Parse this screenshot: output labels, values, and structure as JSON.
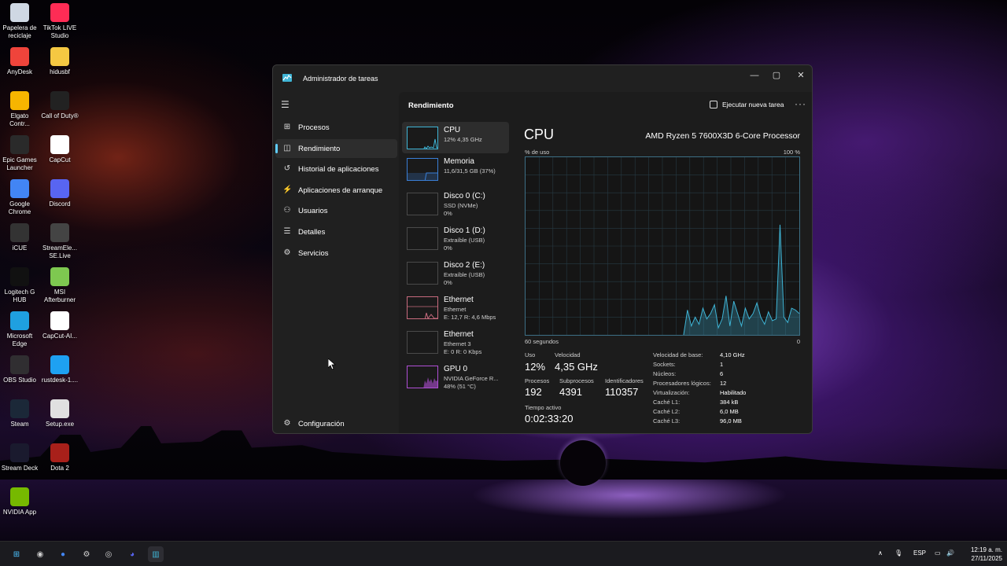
{
  "desktop_icons": [
    {
      "label": "Papelera de reciclaje",
      "icon": "recycle-bin-icon",
      "color": "#cfd8e3"
    },
    {
      "label": "TikTok LIVE Studio",
      "icon": "tiktok-icon",
      "color": "#fe2c55"
    },
    {
      "label": "AnyDesk",
      "icon": "anydesk-icon",
      "color": "#ef443b"
    },
    {
      "label": "hidusbf",
      "icon": "folder-icon",
      "color": "#f5c842"
    },
    {
      "label": "Elgato Contr...",
      "icon": "elgato-icon",
      "color": "#f7b500"
    },
    {
      "label": "Call of Duty®",
      "icon": "call-of-duty-icon",
      "color": "#222222"
    },
    {
      "label": "Epic Games Launcher",
      "icon": "epic-games-icon",
      "color": "#2a2a2a"
    },
    {
      "label": "CapCut",
      "icon": "capcut-icon",
      "color": "#ffffff"
    },
    {
      "label": "Google Chrome",
      "icon": "chrome-icon",
      "color": "#4285f4"
    },
    {
      "label": "Discord",
      "icon": "discord-icon",
      "color": "#5865f2"
    },
    {
      "label": "iCUE",
      "icon": "icue-icon",
      "color": "#333333"
    },
    {
      "label": "StreamEle... SE.Live",
      "icon": "streamelements-icon",
      "color": "#444444"
    },
    {
      "label": "Logitech G HUB",
      "icon": "logitech-icon",
      "color": "#111111"
    },
    {
      "label": "MSI Afterburner",
      "icon": "msi-afterburner-icon",
      "color": "#7ec850"
    },
    {
      "label": "Microsoft Edge",
      "icon": "edge-icon",
      "color": "#1fa0e0"
    },
    {
      "label": "CapCut-AI...",
      "icon": "capcut-ai-icon",
      "color": "#ffffff"
    },
    {
      "label": "OBS Studio",
      "icon": "obs-icon",
      "color": "#302e31"
    },
    {
      "label": "rustdesk-1....",
      "icon": "rustdesk-icon",
      "color": "#1ea1f2"
    },
    {
      "label": "Steam",
      "icon": "steam-icon",
      "color": "#1b2838"
    },
    {
      "label": "Setup.exe",
      "icon": "setup-icon",
      "color": "#e0e0e0"
    },
    {
      "label": "Stream Deck",
      "icon": "stream-deck-icon",
      "color": "#1a1a2e"
    },
    {
      "label": "Dota 2",
      "icon": "dota2-icon",
      "color": "#a8201a"
    },
    {
      "label": "NVIDIA App",
      "icon": "nvidia-icon",
      "color": "#76b900"
    }
  ],
  "window": {
    "title": "Administrador de tareas",
    "controls": {
      "minimize": "—",
      "maximize": "▢",
      "close": "✕"
    }
  },
  "nav": {
    "items": [
      {
        "label": "Procesos",
        "icon": "processes-icon",
        "glyph": "⊞"
      },
      {
        "label": "Rendimiento",
        "icon": "performance-icon",
        "glyph": "◫"
      },
      {
        "label": "Historial de aplicaciones",
        "icon": "history-icon",
        "glyph": "↺"
      },
      {
        "label": "Aplicaciones de arranque",
        "icon": "startup-icon",
        "glyph": "⚡"
      },
      {
        "label": "Usuarios",
        "icon": "users-icon",
        "glyph": "⚇"
      },
      {
        "label": "Detalles",
        "icon": "details-icon",
        "glyph": "☰"
      },
      {
        "label": "Servicios",
        "icon": "services-icon",
        "glyph": "⚙"
      }
    ],
    "settings": "Configuración"
  },
  "header": {
    "title": "Rendimiento",
    "run_task": "Ejecutar nueva tarea",
    "more": "···"
  },
  "resources": [
    {
      "name": "CPU",
      "sub1": "12% 4,35 GHz",
      "sub2": "",
      "sub3": "",
      "color": "#3fb5d6"
    },
    {
      "name": "Memoria",
      "sub1": "11,6/31,5 GB (37%)",
      "sub2": "",
      "sub3": "",
      "color": "#3a7fd6"
    },
    {
      "name": "Disco 0 (C:)",
      "sub1": "SSD (NVMe)",
      "sub2": "0%",
      "sub3": "",
      "color": "#4ca843"
    },
    {
      "name": "Disco 1 (D:)",
      "sub1": "Extraíble (USB)",
      "sub2": "0%",
      "sub3": "",
      "color": "#4ca843"
    },
    {
      "name": "Disco 2 (E:)",
      "sub1": "Extraíble (USB)",
      "sub2": "0%",
      "sub3": "",
      "color": "#4ca843"
    },
    {
      "name": "Ethernet",
      "sub1": "Ethernet",
      "sub2": "E: 12,7 R: 4,6 Mbps",
      "sub3": "",
      "color": "#c86b7e"
    },
    {
      "name": "Ethernet",
      "sub1": "Ethernet 3",
      "sub2": "E: 0 R: 0 Kbps",
      "sub3": "",
      "color": "#c86b7e"
    },
    {
      "name": "GPU 0",
      "sub1": "NVIDIA GeForce R...",
      "sub2": "48% (51 °C)",
      "sub3": "",
      "color": "#b04fd6"
    }
  ],
  "cpu": {
    "title": "CPU",
    "model": "AMD Ryzen 5 7600X3D 6-Core Processor",
    "graph_top_left": "% de uso",
    "graph_top_right": "100 %",
    "graph_bottom_left": "60 segundos",
    "graph_bottom_right": "0",
    "usage_label": "Uso",
    "usage_value": "12%",
    "speed_label": "Velocidad",
    "speed_value": "4,35 GHz",
    "processes_label": "Procesos",
    "processes_value": "192",
    "threads_label": "Subprocesos",
    "threads_value": "4391",
    "handles_label": "Identificadores",
    "handles_value": "110357",
    "uptime_label": "Tiempo activo",
    "uptime_value": "0:02:33:20",
    "specs": [
      {
        "k": "Velocidad de base:",
        "v": "4,10 GHz"
      },
      {
        "k": "Sockets:",
        "v": "1"
      },
      {
        "k": "Núcleos:",
        "v": "6"
      },
      {
        "k": "Procesadores lógicos:",
        "v": "12"
      },
      {
        "k": "Virtualización:",
        "v": "Habilitado"
      },
      {
        "k": "Caché L1:",
        "v": "384 kB"
      },
      {
        "k": "Caché L2:",
        "v": "6,0 MB"
      },
      {
        "k": "Caché L3:",
        "v": "96,0 MB"
      }
    ],
    "usage_history": [
      0,
      0,
      0,
      0,
      0,
      0,
      0,
      0,
      0,
      0,
      0,
      0,
      0,
      0,
      0,
      0,
      0,
      0,
      0,
      0,
      0,
      0,
      0,
      0,
      0,
      0,
      0,
      0,
      0,
      0,
      0,
      0,
      0,
      0,
      0,
      0,
      0,
      0,
      0,
      0,
      0,
      0,
      14,
      5,
      10,
      6,
      15,
      9,
      12,
      17,
      4,
      9,
      22,
      5,
      19,
      12,
      5,
      15,
      9,
      12,
      18,
      10,
      6,
      13,
      8,
      9,
      62,
      10,
      7,
      15,
      14,
      12
    ]
  },
  "taskbar": {
    "apps": [
      {
        "icon": "windows-start-icon",
        "color": "#4cc2ff",
        "glyph": "⊞"
      },
      {
        "icon": "obs-taskbar-icon",
        "color": "#cfcfcf",
        "glyph": "◉"
      },
      {
        "icon": "chrome-taskbar-icon",
        "color": "#4285f4",
        "glyph": "●"
      },
      {
        "icon": "steam-taskbar-icon",
        "color": "#d0d0d0",
        "glyph": "⚙"
      },
      {
        "icon": "icue-taskbar-icon",
        "color": "#d0d0d0",
        "glyph": "◎"
      },
      {
        "icon": "discord-taskbar-icon",
        "color": "#5865f2",
        "glyph": "◕"
      },
      {
        "icon": "task-manager-taskbar-icon",
        "color": "#3fb5d6",
        "glyph": "▥"
      }
    ],
    "tray": {
      "chevron": "∧",
      "mic": "🎙",
      "language": "ESP",
      "network": "▭",
      "volume": "🔊"
    },
    "time": "12:19 a. m.",
    "date": "27/11/2025"
  }
}
